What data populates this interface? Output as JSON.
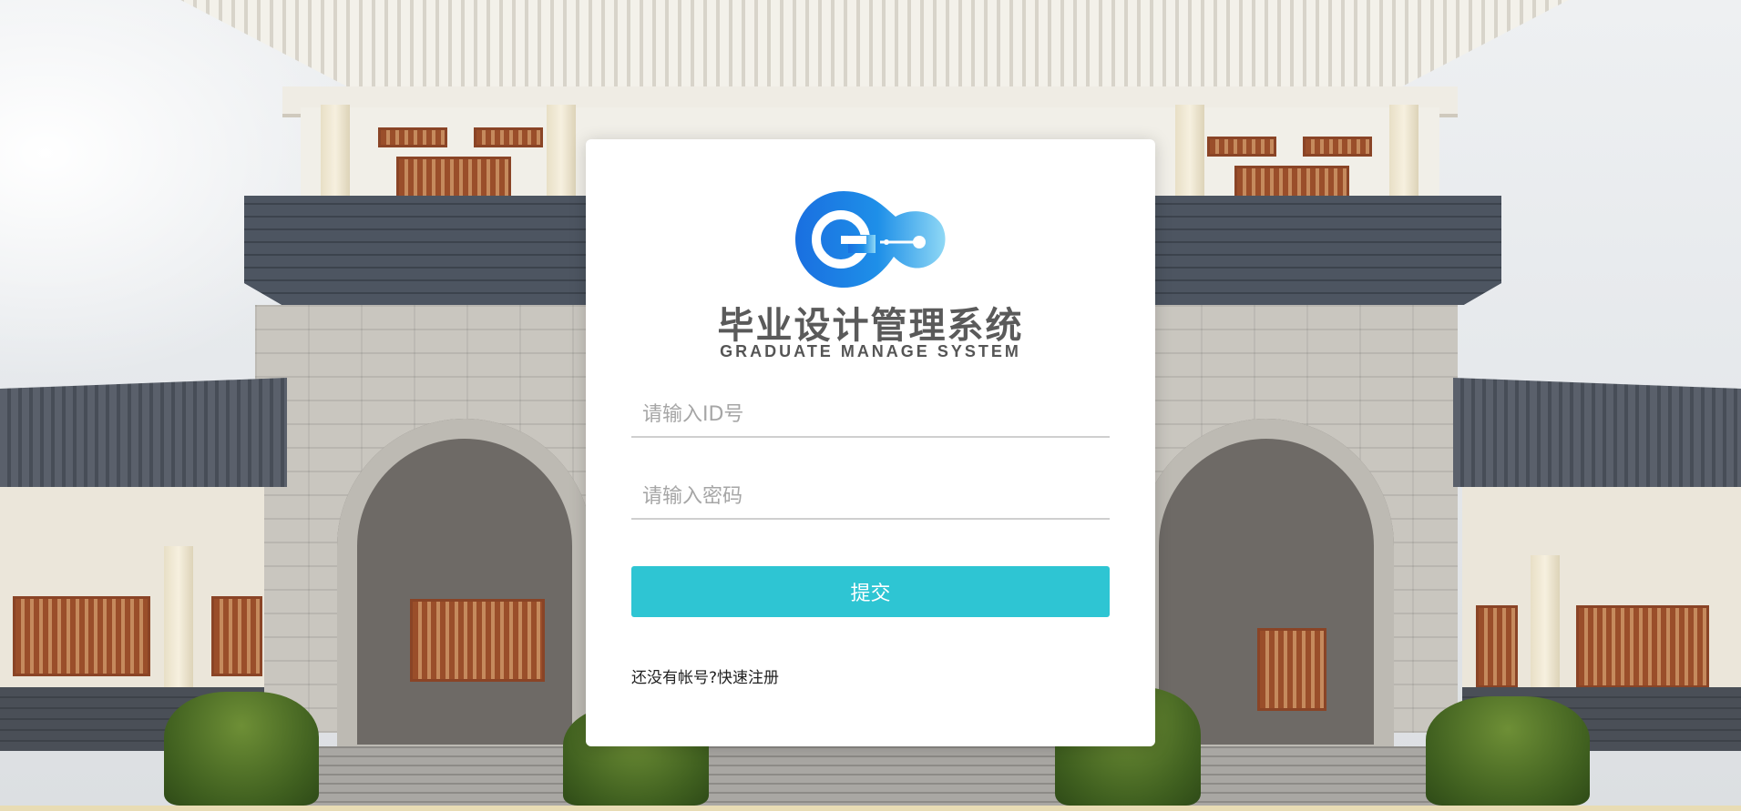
{
  "app": {
    "logo_title": "毕业设计管理系统",
    "logo_subtitle": "GRADUATE MANAGE SYSTEM",
    "logo_icon": "g-logo-icon"
  },
  "form": {
    "id_placeholder": "请输入ID号",
    "id_value": "",
    "password_placeholder": "请输入密码",
    "password_value": "",
    "submit_label": "提交"
  },
  "register": {
    "prompt": "还没有帐号?",
    "link_label": "快速注册"
  },
  "colors": {
    "accent": "#2ec5d3",
    "card": "#ffffff",
    "logo_blue": "#1a73e8"
  },
  "background": {
    "description_icon": "campus-building-photo"
  }
}
